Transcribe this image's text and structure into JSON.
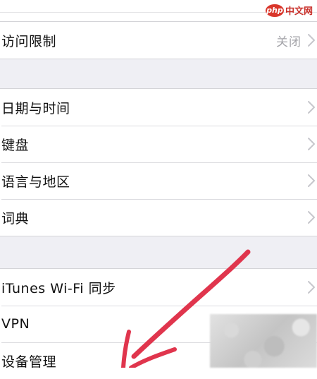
{
  "watermark": {
    "logo_text": "php",
    "site_text": "中文网"
  },
  "group1": {
    "items": [
      {
        "label": "访问限制",
        "value": "关闭"
      }
    ]
  },
  "group2": {
    "items": [
      {
        "label": "日期与时间"
      },
      {
        "label": "键盘"
      },
      {
        "label": "语言与地区"
      },
      {
        "label": "词典"
      }
    ]
  },
  "group3": {
    "items": [
      {
        "label": "iTunes Wi-Fi 同步"
      },
      {
        "label": "VPN"
      },
      {
        "label": "设备管理"
      }
    ]
  },
  "colors": {
    "background": "#efeff4",
    "cell": "#ffffff",
    "secondary_text": "#a3a3a8",
    "annotation_arrow": "#e0354d"
  }
}
